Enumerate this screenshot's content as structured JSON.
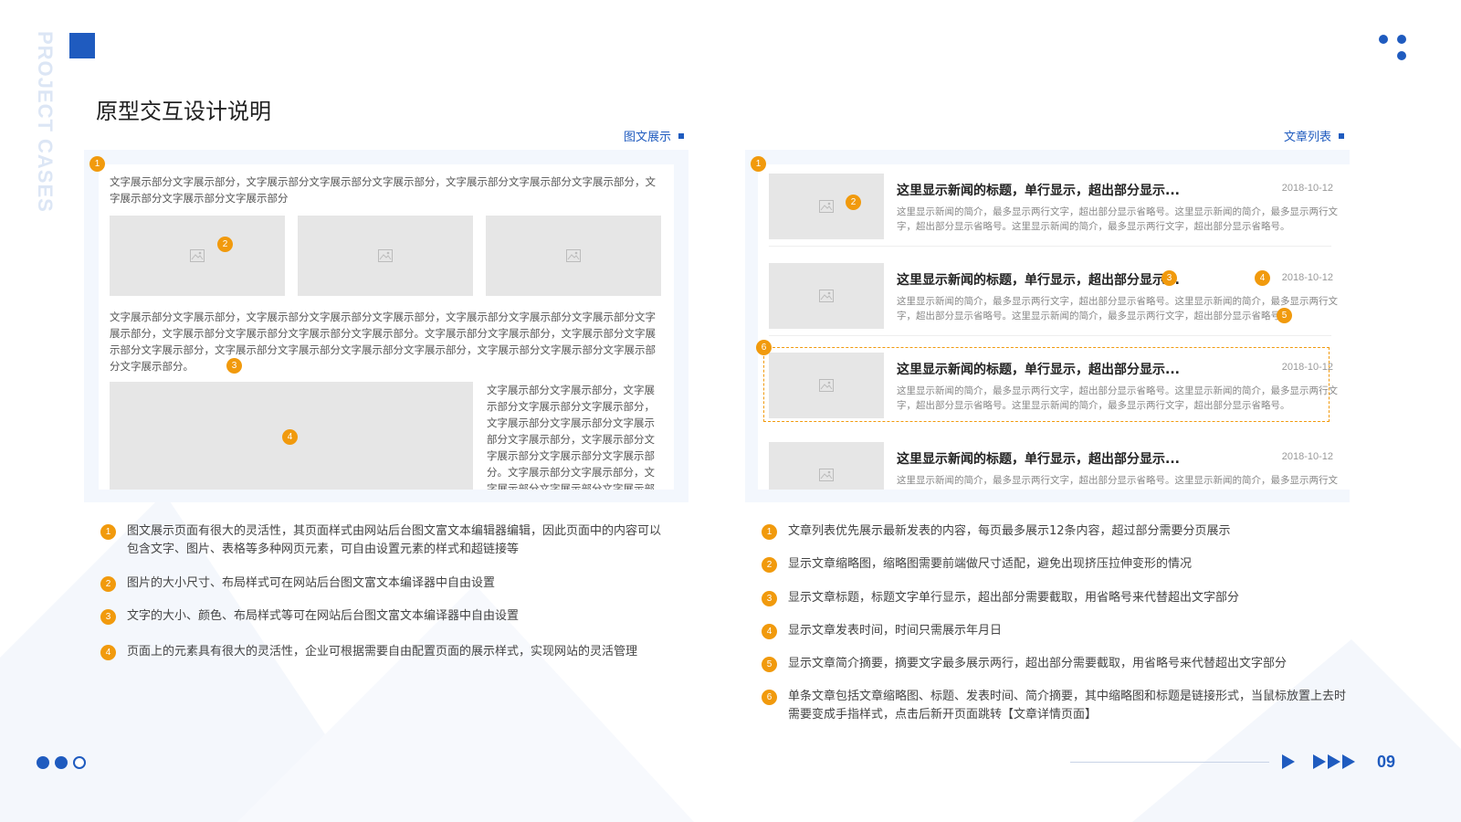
{
  "brand": {
    "vertical_text": "PROJECT CASES",
    "accent": "#1f5bbf",
    "badge_color": "#f19a0d"
  },
  "page": {
    "title": "原型交互设计说明",
    "number": "09"
  },
  "left": {
    "label": "图文展示",
    "para1": "文字展示部分文字展示部分，文字展示部分文字展示部分文字展示部分，文字展示部分文字展示部分文字展示部分，文字展示部分文字展示部分文字展示部分",
    "para2": "文字展示部分文字展示部分，文字展示部分文字展示部分文字展示部分，文字展示部分文字展示部分文字展示部分文字展示部分，文字展示部分文字展示部分文字展示部分文字展示部分。文字展示部分文字展示部分，文字展示部分文字展示部分文字展示部分，文字展示部分文字展示部分文字展示部分文字展示部分，文字展示部分文字展示部分文字展示部分文字展示部分。",
    "para3": "文字展示部分文字展示部分，文字展示部分文字展示部分文字展示部分，文字展示部分文字展示部分文字展示部分文字展示部分，文字展示部分文字展示部分文字展示部分文字展示部分。文字展示部分文字展示部分，文字展示部分文字展示部分文字展示部分",
    "notes": [
      {
        "n": "1",
        "text": "图文展示页面有很大的灵活性，其页面样式由网站后台图文富文本编辑器编辑，因此页面中的内容可以包含文字、图片、表格等多种网页元素，可自由设置元素的样式和超链接等"
      },
      {
        "n": "2",
        "text": "图片的大小尺寸、布局样式可在网站后台图文富文本编译器中自由设置"
      },
      {
        "n": "3",
        "text": "文字的大小、颜色、布局样式等可在网站后台图文富文本编译器中自由设置"
      },
      {
        "n": "4",
        "text": "页面上的元素具有很大的灵活性，企业可根据需要自由配置页面的展示样式，实现网站的灵活管理"
      }
    ]
  },
  "right": {
    "label": "文章列表",
    "articles": [
      {
        "title": "这里显示新闻的标题，单行显示，超出部分显示...",
        "date": "2018-10-12",
        "summary": "这里显示新闻的简介，最多显示两行文字，超出部分显示省略号。这里显示新闻的简介，最多显示两行文字，超出部分显示省略号。这里显示新闻的简介，最多显示两行文字，超出部分显示省略号。"
      },
      {
        "title": "这里显示新闻的标题，单行显示，超出部分显示...",
        "date": "2018-10-12",
        "summary": "这里显示新闻的简介，最多显示两行文字，超出部分显示省略号。这里显示新闻的简介，最多显示两行文字，超出部分显示省略号。这里显示新闻的简介，最多显示两行文字，超出部分显示省略号。"
      },
      {
        "title": "这里显示新闻的标题，单行显示，超出部分显示...",
        "date": "2018-10-12",
        "summary": "这里显示新闻的简介，最多显示两行文字，超出部分显示省略号。这里显示新闻的简介，最多显示两行文字，超出部分显示省略号。这里显示新闻的简介，最多显示两行文字，超出部分显示省略号。"
      },
      {
        "title": "这里显示新闻的标题，单行显示，超出部分显示...",
        "date": "2018-10-12",
        "summary": "这里显示新闻的简介，最多显示两行文字，超出部分显示省略号。这里显示新闻的简介，最多显示两行文字，超出部分显示省略号。这里显示新闻的简介，最多显示两行文字"
      }
    ],
    "notes": [
      {
        "n": "1",
        "text": "文章列表优先展示最新发表的内容，每页最多展示12条内容，超过部分需要分页展示"
      },
      {
        "n": "2",
        "text": "显示文章缩略图，缩略图需要前端做尺寸适配，避免出现挤压拉伸变形的情况"
      },
      {
        "n": "3",
        "text": "显示文章标题，标题文字单行显示，超出部分需要截取，用省略号来代替超出文字部分"
      },
      {
        "n": "4",
        "text": "显示文章发表时间，时间只需展示年月日"
      },
      {
        "n": "5",
        "text": "显示文章简介摘要，摘要文字最多展示两行，超出部分需要截取，用省略号来代替超出文字部分"
      },
      {
        "n": "6",
        "text": "单条文章包括文章缩略图、标题、发表时间、简介摘要，其中缩略图和标题是链接形式，当鼠标放置上去时需要变成手指样式，点击后新开页面跳转【文章详情页面】"
      }
    ]
  },
  "badges": {
    "b1": "1",
    "b2": "2",
    "b3": "3",
    "b4": "4",
    "b5": "5",
    "b6": "6"
  }
}
